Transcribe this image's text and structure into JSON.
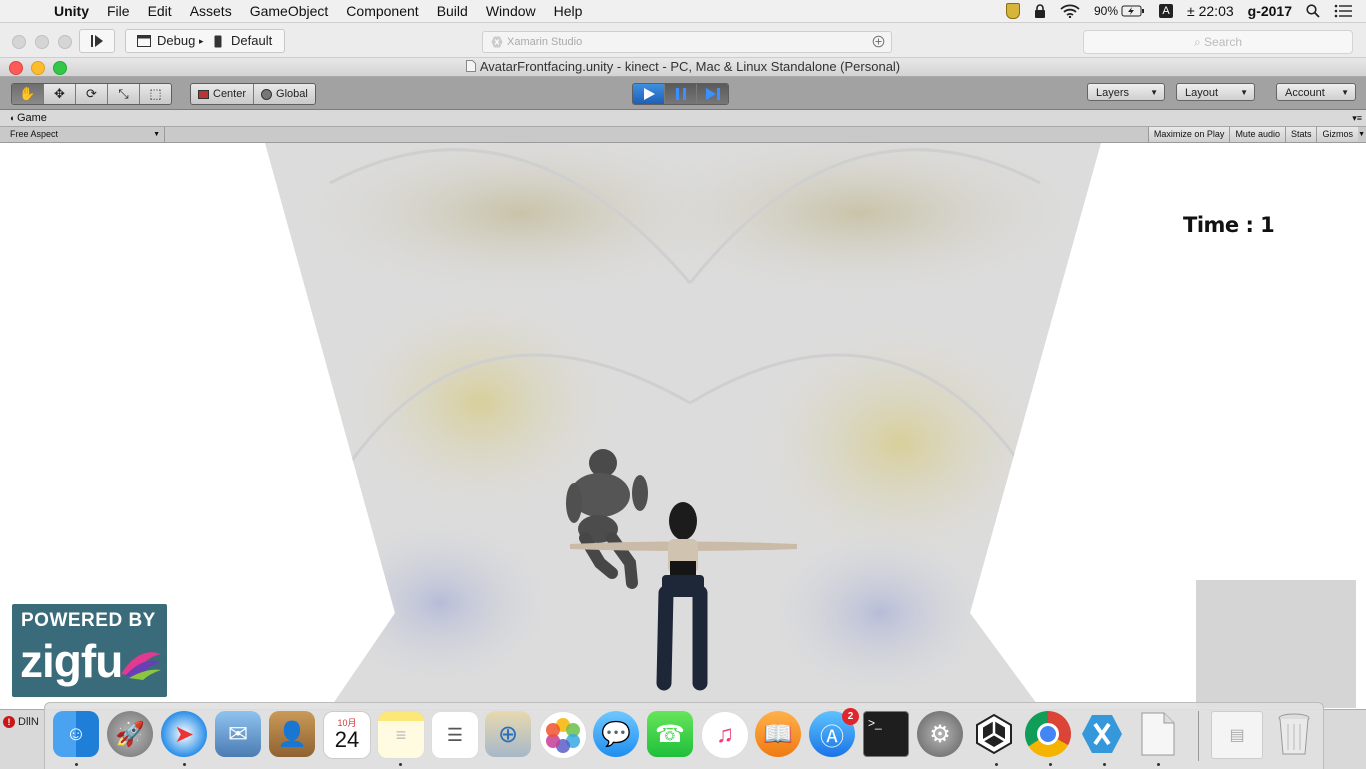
{
  "menubar": {
    "app_name": "Unity",
    "items": [
      "File",
      "Edit",
      "Assets",
      "GameObject",
      "Component",
      "Build",
      "Window",
      "Help"
    ],
    "battery": "90%",
    "input_source": "A",
    "clock": "± 22:03",
    "user": "g-2017"
  },
  "xamarin": {
    "config": "Debug",
    "target": "Default",
    "center_title": "Xamarin Studio",
    "search_placeholder": "Search"
  },
  "unity": {
    "window_title": "AvatarFrontfacing.unity - kinect - PC, Mac & Linux Standalone (Personal)",
    "pivot_center": "Center",
    "pivot_global": "Global",
    "layers": "Layers",
    "layout": "Layout",
    "account": "Account"
  },
  "game": {
    "tab_label": "Game",
    "aspect": "Free Aspect",
    "options": [
      "Maximize on Play",
      "Mute audio",
      "Stats",
      "Gizmos"
    ],
    "time_label": "Time : 1",
    "logo_line1": "POWERED BY",
    "logo_line2": "zigfu"
  },
  "status": {
    "error_text": "DllN"
  },
  "dock": {
    "calendar_month": "10月",
    "calendar_day": "24",
    "appstore_badge": "2",
    "terminal_prompt": ">_"
  },
  "colors": {
    "play_blue": "#2a73cc",
    "zigfu_teal": "#3a6b7b"
  }
}
